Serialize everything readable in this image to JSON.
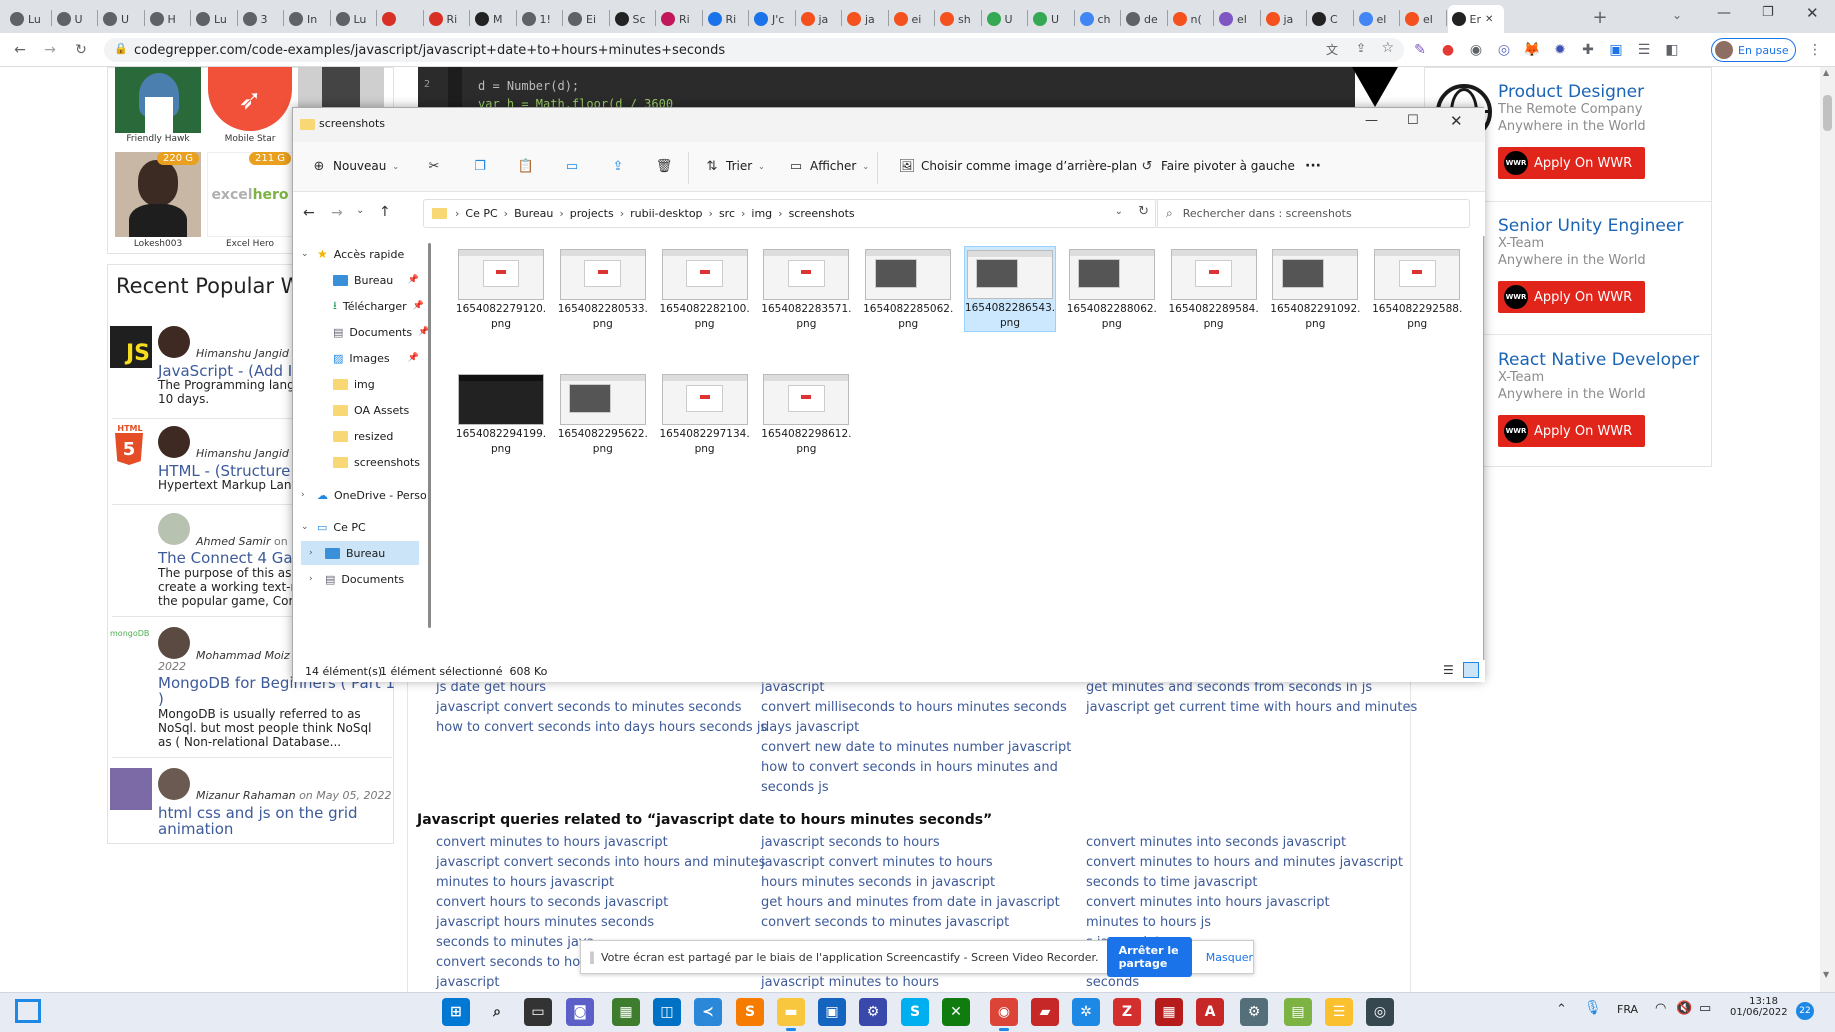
{
  "browser": {
    "tabs": [
      "Lu",
      "U",
      "U",
      "H",
      "Lu",
      "3",
      "In",
      "Lu",
      "",
      "Ri",
      "M",
      "1!",
      "Ei",
      "Sc",
      "Ri",
      "Ri",
      "J'c",
      "ja",
      "ja",
      "ei",
      "sh",
      "U",
      "U",
      "ch",
      "de",
      "n(",
      "el",
      "ja",
      "C",
      "el",
      "el",
      "Er"
    ],
    "address": "codegrepper.com/code-examples/javascript/javascript+date+to+hours+minutes+seconds",
    "profile_status": "En pause"
  },
  "left_sidebar": {
    "top_users": [
      {
        "name": "Friendly Hawk",
        "score": ""
      },
      {
        "name": "Mobile Star",
        "score": ""
      },
      {
        "name": "Lokesh003",
        "score": "220 G"
      },
      {
        "name": "Excel Hero",
        "score": "211 G"
      }
    ],
    "section_title": "Recent Popular W",
    "posts": [
      {
        "author": "Himanshu Jangid",
        "meta": "o",
        "title": "JavaScript - (Add In",
        "excerpt_1": "The Programming lang",
        "excerpt_2": "10 days.",
        "excerpt_3": "",
        "excerpt_4": "",
        "logo": "JS"
      },
      {
        "author": "Himanshu Jangid",
        "meta": "o",
        "title": "HTML - (Structure Y",
        "excerpt_1": "Hypertext Markup Lang",
        "excerpt_2": "",
        "excerpt_3": "",
        "excerpt_4": "",
        "logo": "HTML"
      },
      {
        "author": "Ahmed Samir",
        "meta": "on M",
        "title": "The Connect 4 Gam",
        "excerpt_1": "The purpose of this as",
        "excerpt_2": "create a working text-r",
        "excerpt_3": "the popular game, Cor",
        "excerpt_4": "",
        "logo": ""
      },
      {
        "author": "Mohammad Moiz A",
        "meta": "2022",
        "title": "MongoDB for Beginners ( Part 1",
        "title_2": ")",
        "excerpt_1": "MongoDB is usually referred to as",
        "excerpt_2": "NoSql. but most people think NoSql",
        "excerpt_3": "as ( Non-relational Database...",
        "excerpt_4": "",
        "logo": "mongoDB"
      },
      {
        "author": "Mizanur Rahaman",
        "meta": "on May 05, 2022",
        "title": "html css and js on the grid",
        "title_2": "animation",
        "excerpt_1": "",
        "excerpt_2": "",
        "excerpt_3": "",
        "excerpt_4": "",
        "logo": ""
      }
    ]
  },
  "code": {
    "line2": "d = Number(d);",
    "line3": "var h = Math.floor(d / 3600"
  },
  "related_top": {
    "col1": [
      "js date get hours",
      "javascript convert seconds to minutes seconds",
      "how to convert seconds into days hours seconds js"
    ],
    "col2": [
      "javascript",
      "convert milliseconds to hours minutes seconds",
      "days javascript",
      "convert new date to minutes number javascript",
      "how to convert seconds in hours minutes and",
      "seconds js"
    ],
    "col3": [
      "get minutes and seconds from seconds in js",
      "javascript get current time with hours and minutes"
    ]
  },
  "queries_heading": "Javascript queries related to “javascript date to hours minutes seconds”",
  "queries": {
    "col1": [
      "convert minutes to hours javascript",
      "javascript convert seconds into hours and minutes",
      "minutes to hours javascript",
      "convert hours to seconds javascript",
      "javascript hours minutes seconds",
      "seconds to minutes java",
      "convert seconds to hour",
      "javascript"
    ],
    "col2": [
      "javascript seconds to hours",
      "javascript convert minutes to hours",
      "hours minutes seconds in javascript",
      "get hours and minutes from date in javascript",
      "convert seconds to minutes javascript",
      "",
      "",
      "javascript minutes to hours"
    ],
    "col3": [
      "convert minutes into seconds javascript",
      "convert minutes to hours and minutes javascript",
      "seconds to time javascript",
      "convert minutes into hours javascript",
      "minutes to hours js",
      "s javascript",
      "hours minutes",
      "seconds"
    ]
  },
  "ads": [
    {
      "title": "Product Designer",
      "company": "The Remote Company",
      "location": "Anywhere in the World",
      "button": "Apply On WWR"
    },
    {
      "title": "Senior Unity Engineer",
      "company": "X-Team",
      "location": "Anywhere in the World",
      "button": "Apply On WWR"
    },
    {
      "title": "React Native Developer",
      "company": "X-Team",
      "location": "Anywhere in the World",
      "button": "Apply On WWR"
    }
  ],
  "explorer": {
    "title": "screenshots",
    "commands": {
      "new": "Nouveau",
      "sort": "Trier",
      "view": "Afficher",
      "wallpaper": "Choisir comme image d’arrière-plan",
      "rotate": "Faire pivoter à gauche",
      "more": "···"
    },
    "breadcrumb": [
      "Ce PC",
      "Bureau",
      "projects",
      "rubii-desktop",
      "src",
      "img",
      "screenshots"
    ],
    "search_placeholder": "Rechercher dans : screenshots",
    "nav": [
      {
        "label": "Accès rapide",
        "pinned": false
      },
      {
        "label": "Bureau",
        "pinned": true
      },
      {
        "label": "Télécharger",
        "pinned": true
      },
      {
        "label": "Documents",
        "pinned": true
      },
      {
        "label": "Images",
        "pinned": true
      },
      {
        "label": "img",
        "pinned": false
      },
      {
        "label": "OA Assets",
        "pinned": false
      },
      {
        "label": "resized",
        "pinned": false
      },
      {
        "label": "screenshots",
        "pinned": false
      },
      {
        "label": "OneDrive - Perso",
        "pinned": false
      },
      {
        "label": "Ce PC",
        "pinned": false
      },
      {
        "label": "Bureau",
        "pinned": false
      },
      {
        "label": "Documents",
        "pinned": false
      }
    ],
    "files": [
      {
        "name": "1654082279120.png",
        "style": "light"
      },
      {
        "name": "1654082280533.png",
        "style": "light"
      },
      {
        "name": "1654082282100.png",
        "style": "light"
      },
      {
        "name": "1654082283571.png",
        "style": "light"
      },
      {
        "name": "1654082285062.png",
        "style": "mixed"
      },
      {
        "name": "1654082286543.png",
        "style": "mixed",
        "selected": true
      },
      {
        "name": "1654082288062.png",
        "style": "mixed"
      },
      {
        "name": "1654082289584.png",
        "style": "light"
      },
      {
        "name": "1654082291092.png",
        "style": "mixed"
      },
      {
        "name": "1654082292588.png",
        "style": "light"
      },
      {
        "name": "1654082294199.png",
        "style": "dark"
      },
      {
        "name": "1654082295622.png",
        "style": "mixed"
      },
      {
        "name": "1654082297134.png",
        "style": "light"
      },
      {
        "name": "1654082298612.png",
        "style": "light"
      }
    ],
    "status_count": "14 élément(s)",
    "status_selected": "1 élément sélectionné  608 Ko"
  },
  "sharebar": {
    "message": "Votre écran est partagé par le biais de l'application Screencastify - Screen Video Recorder.",
    "stop": "Arrêter le partage",
    "hide": "Masquer"
  },
  "taskbar": {
    "lang": "FRA",
    "time": "13:18",
    "date": "01/06/2022",
    "badge": "22"
  }
}
